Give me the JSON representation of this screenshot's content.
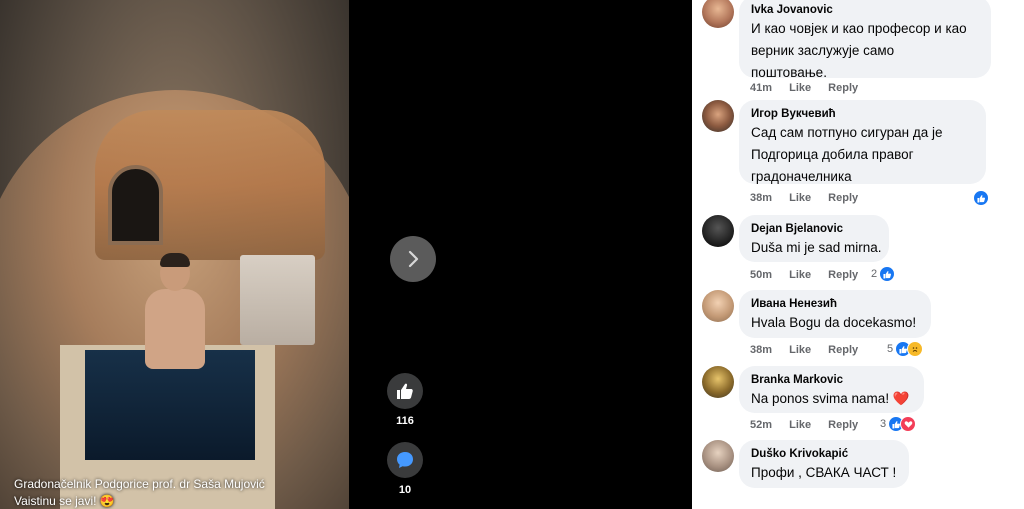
{
  "post": {
    "caption_line1": "Gradonačelnik Podgorice prof. dr Saša Mujović",
    "caption_line2": "Vaistinu se javi! 😍",
    "likes_count": "116",
    "comments_count": "10"
  },
  "comments": [
    {
      "author": "Ivka Jovanovic",
      "lines": [
        "И као човјек и као професор и као",
        "верник заслужује само",
        "поштовање."
      ],
      "time": "41m",
      "like": "Like",
      "reply": "Reply",
      "reactions": ""
    },
    {
      "author": "Игор Вукчевић",
      "lines": [
        "Сад сам потпуно сигуран да је",
        "Подгорица добила правог",
        "градоначелника"
      ],
      "time": "38m",
      "like": "Like",
      "reply": "Reply",
      "reactions": ""
    },
    {
      "author": "Dejan Bjelanovic",
      "lines": [
        "Duša mi je sad mirna."
      ],
      "time": "50m",
      "like": "Like",
      "reply": "Reply",
      "reactions": "2"
    },
    {
      "author": "Ивана Ненезић",
      "lines": [
        "Hvala Bogu da docekasmo!"
      ],
      "time": "38m",
      "like": "Like",
      "reply": "Reply",
      "reactions": "5"
    },
    {
      "author": "Branka Markovic",
      "lines": [
        "Na ponos svima nama! ❤️"
      ],
      "time": "52m",
      "like": "Like",
      "reply": "Reply",
      "reactions": "3"
    },
    {
      "author": "Duško Krivokapić",
      "lines": [
        "Профи , СВАКА ЧАСТ !"
      ],
      "time": "",
      "like": "",
      "reply": "",
      "reactions": ""
    }
  ],
  "colors": {
    "accent": "#1877f2",
    "bubble": "#f0f2f5",
    "meta": "#65676b"
  },
  "icons": [
    "chevron-right-icon",
    "thumbs-up-icon",
    "comment-icon",
    "heart-icon",
    "sad-face-icon"
  ]
}
